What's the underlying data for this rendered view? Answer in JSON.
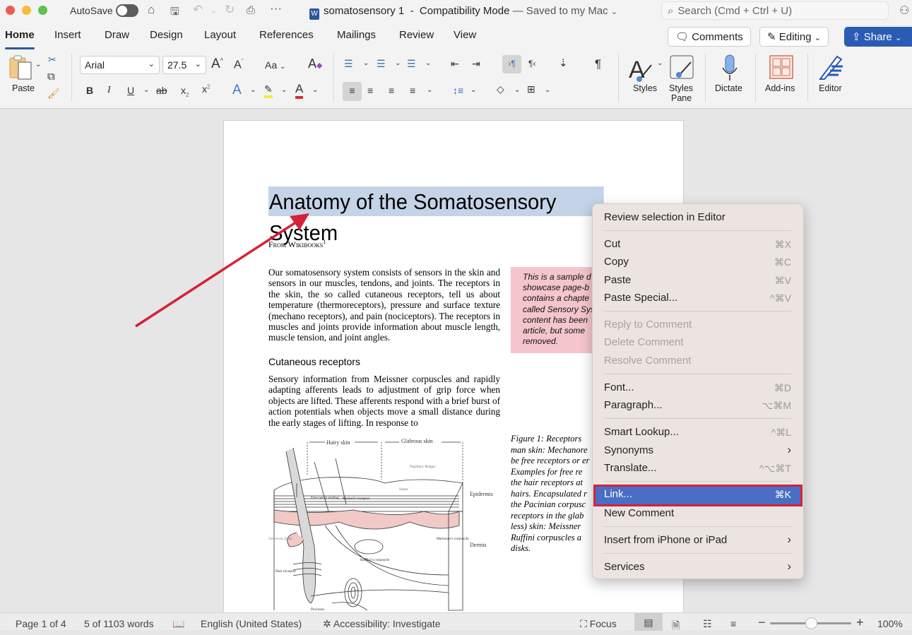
{
  "window": {
    "autosave_label": "AutoSave",
    "autosave_on": false,
    "doc_name": "somatosensory 1",
    "doc_mode": "Compatibility Mode",
    "doc_saved": "— Saved to my Mac",
    "search_placeholder": "Search (Cmd + Ctrl + U)"
  },
  "tabs": [
    "Home",
    "Insert",
    "Draw",
    "Design",
    "Layout",
    "References",
    "Mailings",
    "Review",
    "View"
  ],
  "active_tab": "Home",
  "header_buttons": {
    "comments": "Comments",
    "editing": "Editing",
    "share": "Share"
  },
  "ribbon": {
    "paste_label": "Paste",
    "font_name": "Arial",
    "font_size": "27.5",
    "change_case": "Aa",
    "styles_label": "Styles",
    "styles_pane_label_1": "Styles",
    "styles_pane_label_2": "Pane",
    "dictate_label": "Dictate",
    "addins_label": "Add-ins",
    "editor_label": "Editor"
  },
  "document": {
    "title": "Anatomy of the Somatosensory System",
    "source": "From Wikibooks",
    "source_sup": "1",
    "para1": "Our somatosensory system consists of sensors in the skin and sensors in our muscles, tendons, and joints. The receptors in the skin, the so called cutaneous receptors, tell us about temperature (thermoreceptors), pressure and surface texture (mechano receptors), and pain (nociceptors). The receptors in muscles and joints provide information about muscle length, muscle tension, and joint angles.",
    "subheading": "Cutaneous receptors",
    "para2": "Sensory information from Meissner corpuscles and rapidly adapting afferents leads to adjustment of grip force when objects are lifted. These afferents respond with a brief burst of action potentials when objects move a small distance during the early stages of lifting. In response to",
    "sidebox_lines": [
      "This is a sample d",
      "showcase page-b",
      "contains a chapte",
      "called Sensory Sys",
      "content has been",
      "article, but some",
      "removed."
    ],
    "caption_lines": [
      "Figure 1: Receptors",
      "man skin: Mechanore",
      "be free receptors or er",
      "Examples for free re",
      "the hair receptors at",
      "hairs. Encapsulated r",
      "the Pacinian corpusc",
      "receptors in the glab",
      "less) skin: Meissner",
      "Ruffini corpuscles a",
      "disks."
    ],
    "figure_labels": {
      "hairy": "Hairy skin",
      "glabrous": "Glabrous skin",
      "papillary": "Papillary Ridges",
      "septa": "Septa",
      "epidermis": "Epidermis",
      "dermis": "Dermis",
      "free_nerve": "Free nerve ending",
      "merkel": "Merkel's receptor",
      "sebaceous": "Sebaceous gland",
      "ruffini": "Ruffini's corpuscle",
      "meissner": "Meissner's corpuscle",
      "hair_receptor": "Hair receptor",
      "pacinian": "Pacinian"
    }
  },
  "context_menu": {
    "items": [
      {
        "label": "Review selection in Editor",
        "shortcut": "",
        "disabled": false
      },
      {
        "label": "Cut",
        "shortcut": "⌘X",
        "disabled": false
      },
      {
        "label": "Copy",
        "shortcut": "⌘C",
        "disabled": false
      },
      {
        "label": "Paste",
        "shortcut": "⌘V",
        "disabled": false
      },
      {
        "label": "Paste Special...",
        "shortcut": "^⌘V",
        "disabled": false
      },
      {
        "label": "Reply to Comment",
        "shortcut": "",
        "disabled": true
      },
      {
        "label": "Delete Comment",
        "shortcut": "",
        "disabled": true
      },
      {
        "label": "Resolve Comment",
        "shortcut": "",
        "disabled": true
      },
      {
        "label": "Font...",
        "shortcut": "⌘D",
        "disabled": false
      },
      {
        "label": "Paragraph...",
        "shortcut": "⌥⌘M",
        "disabled": false
      },
      {
        "label": "Smart Lookup...",
        "shortcut": "^⌘L",
        "disabled": false
      },
      {
        "label": "Synonyms",
        "shortcut": "›",
        "disabled": false
      },
      {
        "label": "Translate...",
        "shortcut": "^⌥⌘T",
        "disabled": false
      },
      {
        "label": "Link...",
        "shortcut": "⌘K",
        "disabled": false,
        "highlighted": true
      },
      {
        "label": "New Comment",
        "shortcut": "",
        "disabled": false
      },
      {
        "label": "Insert from iPhone or iPad",
        "shortcut": "›",
        "disabled": false
      },
      {
        "label": "Services",
        "shortcut": "›",
        "disabled": false
      }
    ]
  },
  "statusbar": {
    "page": "Page 1 of 4",
    "words": "5 of 1103 words",
    "language": "English (United States)",
    "accessibility": "Accessibility: Investigate",
    "focus": "Focus",
    "zoom": "100%",
    "zoom_slider_fraction": 0.5
  },
  "colors": {
    "accent": "#2b579a",
    "share": "#2b5cb5",
    "selection": "#c5d3e8",
    "menu_highlight": "#4a6ec3",
    "annotation_red": "#d52137"
  }
}
